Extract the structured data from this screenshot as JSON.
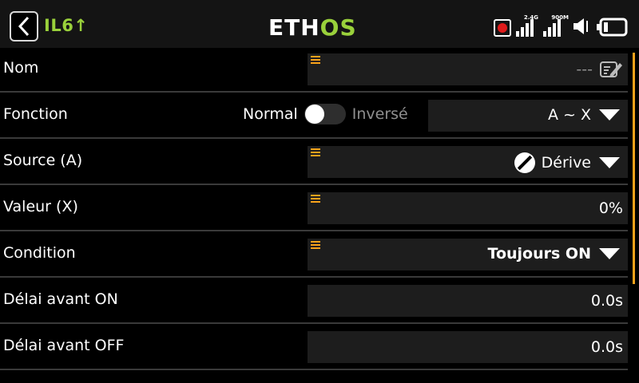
{
  "header": {
    "model_name": "IL6↑",
    "logo_a": "ETH",
    "logo_b": "OS",
    "signal1_label": "2.4G",
    "signal2_label": "900M"
  },
  "rows": [
    {
      "label": "Nom",
      "value": "---"
    },
    {
      "label": "Fonction",
      "switch_on": "Normal",
      "switch_off": "Inversé",
      "value": "A ~ X"
    },
    {
      "label": "Source (A)",
      "value": "Dérive"
    },
    {
      "label": "Valeur (X)",
      "value": "0%"
    },
    {
      "label": "Condition",
      "value": "Toujours ON"
    },
    {
      "label": "Délai avant ON",
      "value": "0.0s"
    },
    {
      "label": "Délai avant OFF",
      "value": "0.0s"
    }
  ],
  "colors": {
    "accent": "#f7a21b",
    "brand_green": "#9ad13b",
    "record": "#e01b1b"
  },
  "icons": [
    "back-icon",
    "record-icon",
    "signal-icon",
    "volume-icon",
    "battery-icon",
    "edit-icon",
    "drift-icon",
    "dropdown-caret-icon",
    "drag-handle-icon"
  ]
}
